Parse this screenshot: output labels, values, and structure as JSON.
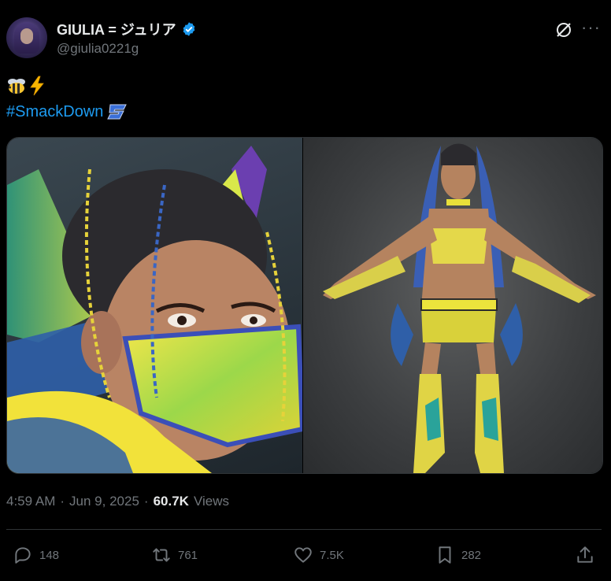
{
  "author": {
    "display_name": "GIULIA = ジュリア",
    "handle": "@giulia0221g",
    "verified": true
  },
  "tweet": {
    "emoji_line": [
      "bee",
      "high-voltage"
    ],
    "hashtag": "#SmackDown",
    "images": [
      {
        "name": "close-up portrait with yellow-green visor mask"
      },
      {
        "name": "full body ring-gear portrait"
      }
    ]
  },
  "meta": {
    "time": "4:59 AM",
    "dot1": "·",
    "date": "Jun 9, 2025",
    "dot2": "·",
    "views_count": "60.7K",
    "views_label": "Views"
  },
  "actions": {
    "replies": "148",
    "reposts": "761",
    "likes": "7.5K",
    "bookmarks": "282"
  },
  "colors": {
    "background": "#000000",
    "text": "#e7e9ea",
    "muted": "#71767b",
    "link": "#1d9bf0",
    "verified": "#1d9bf0",
    "divider": "#2f3336"
  }
}
